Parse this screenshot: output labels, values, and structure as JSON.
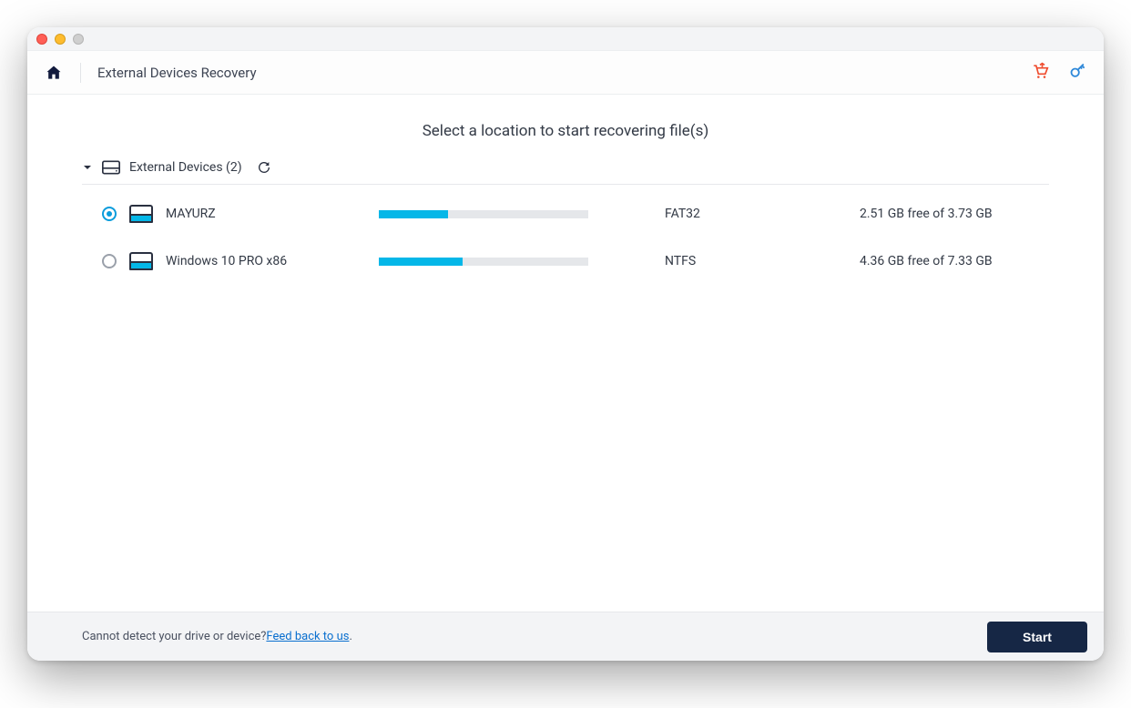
{
  "header": {
    "title": "External Devices Recovery"
  },
  "main": {
    "instruction": "Select a location to start recovering file(s)",
    "section_label": "External Devices (2)"
  },
  "devices": [
    {
      "name": "MAYURZ",
      "filesystem": "FAT32",
      "free_gb": 2.51,
      "total_gb": 3.73,
      "space_text": "2.51 GB free of 3.73 GB",
      "used_pct": 33,
      "selected": true
    },
    {
      "name": "Windows 10 PRO x86",
      "filesystem": "NTFS",
      "free_gb": 4.36,
      "total_gb": 7.33,
      "space_text": "4.36 GB free of 7.33 GB",
      "used_pct": 40,
      "selected": false
    }
  ],
  "footer": {
    "text": "Cannot detect your drive or device? ",
    "link": "Feed back to us",
    "period": ".",
    "start_label": "Start"
  }
}
